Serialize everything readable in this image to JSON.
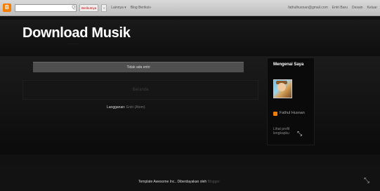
{
  "navbar": {
    "logo": "B",
    "search_icon": "Q",
    "search_blog_label": "Berikutnya",
    "next_symbol": "»",
    "more_label": "Lainnya ▾",
    "next_blog_label": "Blog Berikut»",
    "email": "fathulhusnan@gmail.com",
    "new_entry": "Entri Baru",
    "design": "Desain",
    "exit": "Keluar"
  },
  "header": {
    "title": "Download Musik",
    "description": "................"
  },
  "main": {
    "no_entry": "Tidak ada entri",
    "home": "Beranda",
    "subscribe_label": "Langganan:",
    "subscribe_link": "Entri (Atom)"
  },
  "sidebar": {
    "title": "Mengenai Saya",
    "profile_name": "Fathul Husnan",
    "profile_link": "Lihat profil lengkapku"
  },
  "footer": {
    "text": "Template Awesome Inc.. Diberdayakan oleh",
    "link": "Blogger."
  }
}
